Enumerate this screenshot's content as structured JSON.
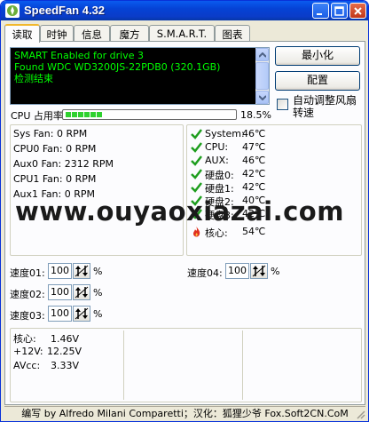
{
  "window": {
    "title": "SpeedFan 4.32",
    "buttons": [
      "minimize",
      "maximize",
      "close"
    ]
  },
  "tabs": [
    {
      "label": "读取",
      "active": true
    },
    {
      "label": "时钟",
      "active": false
    },
    {
      "label": "信息",
      "active": false
    },
    {
      "label": "魔方",
      "active": false
    },
    {
      "label": "S.M.A.R.T.",
      "active": false
    },
    {
      "label": "图表",
      "active": false
    }
  ],
  "log": {
    "lines": [
      "SMART Enabled for drive 3",
      "Found WDC WD3200JS-22PDB0 (320.1GB)",
      "检测结束"
    ]
  },
  "actions": {
    "minimize_label": "最小化",
    "config_label": "配置",
    "auto_fan_label": "自动调整风扇转速",
    "auto_fan_checked": false
  },
  "cpu_usage": {
    "label": "CPU 占用率",
    "percent_text": "18.5%",
    "value": 0.185
  },
  "fans": [
    {
      "name": "Sys Fan:",
      "value": "0 RPM"
    },
    {
      "name": "CPU0 Fan:",
      "value": "0 RPM"
    },
    {
      "name": "Aux0 Fan:",
      "value": "2312 RPM"
    },
    {
      "name": "CPU1 Fan:",
      "value": "0 RPM"
    },
    {
      "name": "Aux1 Fan:",
      "value": "0 RPM"
    }
  ],
  "temps": [
    {
      "name": "System:",
      "value": "46℃",
      "icon": "check-icon"
    },
    {
      "name": "CPU:",
      "value": "47℃",
      "icon": "check-icon"
    },
    {
      "name": "AUX:",
      "value": "46℃",
      "icon": "check-icon"
    },
    {
      "name": "硬盘0:",
      "value": "42℃",
      "icon": "check-icon"
    },
    {
      "name": "硬盘1:",
      "value": "42℃",
      "icon": "check-icon"
    },
    {
      "name": "硬盘2:",
      "value": "40℃",
      "icon": "check-icon"
    },
    {
      "name": "硬盘3:",
      "value": "42℃",
      "icon": "check-icon"
    },
    {
      "name": "核心:",
      "value": "54℃",
      "icon": "flame-icon"
    }
  ],
  "speeds": [
    {
      "label": "速度01:",
      "value": "100",
      "unit": "%"
    },
    {
      "label": "速度02:",
      "value": "100",
      "unit": "%"
    },
    {
      "label": "速度03:",
      "value": "100",
      "unit": "%"
    },
    {
      "label": "速度04:",
      "value": "100",
      "unit": "%"
    }
  ],
  "voltages": [
    {
      "name": "核心:",
      "value": "1.46V"
    },
    {
      "name": "+12V:",
      "value": "12.25V"
    },
    {
      "name": "AVcc:",
      "value": "3.33V"
    }
  ],
  "status_text": "编写 by Alfredo Milani Comparetti；汉化：狐狸少爷 Fox.Soft2CN.CoM",
  "watermark": "www.ouyaoxiazai.com",
  "colors": {
    "title_bar": "#0542D5",
    "log_text": "#00FF00",
    "ok_icon": "#1E9E1E",
    "hot_icon": "#E0301E",
    "tab_highlight": "#F1B82E"
  }
}
